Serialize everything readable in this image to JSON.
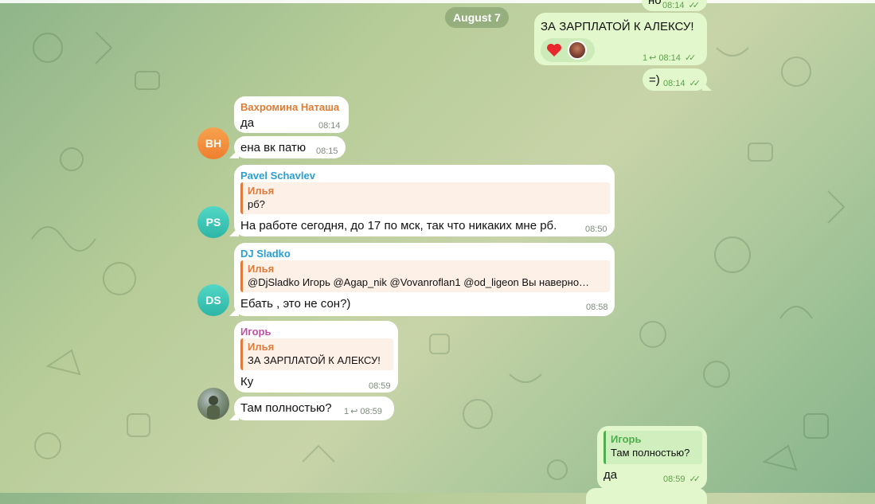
{
  "date_separator": "August 7",
  "top_partial": {
    "text": "но",
    "time": "08:14"
  },
  "outgoing": [
    {
      "text": "ЗА ЗАРПЛАТОЙ К АЛЕКСУ!",
      "reply_count": "1",
      "time": "08:14"
    },
    {
      "text": "=)",
      "time": "08:14"
    }
  ],
  "groups": [
    {
      "avatar_initials": "ВН",
      "avatar_color": "#f3903f",
      "name": "Вахромина Наташа",
      "name_color": "#e07b2f",
      "messages": [
        {
          "text": "да",
          "time": "08:14"
        },
        {
          "text": "ена вк патю",
          "time": "08:15"
        }
      ]
    },
    {
      "avatar_initials": "PS",
      "avatar_color": "#3cc6b8",
      "name": "Pavel Schavlev",
      "name_color": "#2a9fd4",
      "quote": {
        "name": "Илья",
        "text": "рб?"
      },
      "text": "На работе сегодня, до 17 по мск, так что никаких мне рб.",
      "time": "08:50"
    },
    {
      "avatar_initials": "DS",
      "avatar_color": "#3cc6b8",
      "name": "DJ Sladko",
      "name_color": "#2a9fd4",
      "quote": {
        "name": "Илья",
        "text": "@DjSladko Игорь @Agap_nik @Vovanroflan1 @od_ligeon Вы наверно…"
      },
      "text": "Ебать , это не сон?)",
      "time": "08:58"
    },
    {
      "name": "Игорь",
      "name_color": "#c251a6",
      "quote": {
        "name": "Илья",
        "text": "ЗА ЗАРПЛАТОЙ К АЛЕКСУ!"
      },
      "text": "Ку",
      "time": "08:59",
      "second": {
        "text": "Там полностью?",
        "reply_count": "1",
        "time": "08:59"
      }
    }
  ],
  "last_outgoing": {
    "quote": {
      "name": "Игорь",
      "text": "Там полностью?"
    },
    "text": "да",
    "time": "08:59"
  },
  "colors": {
    "outgoing_bubble": "#e2f7cb",
    "incoming_bubble": "#ffffff",
    "check": "#5fa04e"
  }
}
